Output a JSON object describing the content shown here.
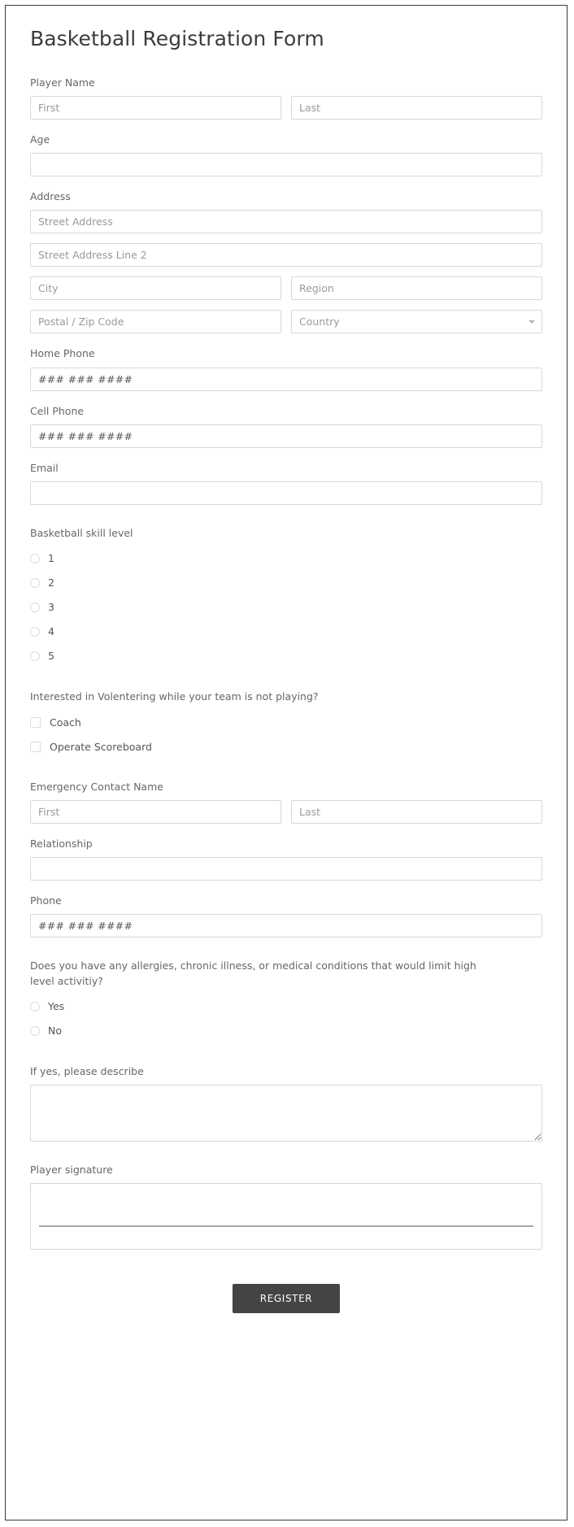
{
  "form": {
    "title": "Basketball Registration Form",
    "submit_label": "REGISTER"
  },
  "colors": {
    "button_background": "#444444",
    "button_text": "#ffffff",
    "label_text": "#666666",
    "input_border": "#d8d8d8",
    "page_border": "#3a3a3a",
    "placeholder": "#9a9a9a"
  },
  "player_name": {
    "label": "Player Name",
    "first_placeholder": "First",
    "first_value": "",
    "last_placeholder": "Last",
    "last_value": ""
  },
  "age": {
    "label": "Age",
    "placeholder": "",
    "value": ""
  },
  "address": {
    "label": "Address",
    "street_placeholder": "Street Address",
    "street_value": "",
    "street2_placeholder": "Street Address Line 2",
    "street2_value": "",
    "city_placeholder": "City",
    "city_value": "",
    "region_placeholder": "Region",
    "region_value": "",
    "postal_placeholder": "Postal / Zip Code",
    "postal_value": "",
    "country_placeholder": "Country",
    "country_value": "",
    "country_chevron": "chevron-down-icon"
  },
  "home_phone": {
    "label": "Home Phone",
    "placeholder": "### ### ####",
    "value": ""
  },
  "cell_phone": {
    "label": "Cell Phone",
    "placeholder": "### ### ####",
    "value": ""
  },
  "email": {
    "label": "Email",
    "placeholder": "",
    "value": ""
  },
  "skill_level": {
    "label": "Basketball skill level",
    "options": [
      {
        "label": "1",
        "selected": false
      },
      {
        "label": "2",
        "selected": false
      },
      {
        "label": "3",
        "selected": false
      },
      {
        "label": "4",
        "selected": false
      },
      {
        "label": "5",
        "selected": false
      }
    ]
  },
  "volunteering": {
    "label": "Interested in Volentering while your team is not playing?",
    "options": [
      {
        "label": "Coach",
        "checked": false
      },
      {
        "label": "Operate Scoreboard",
        "checked": false
      }
    ]
  },
  "emergency_contact": {
    "label": "Emergency Contact Name",
    "first_placeholder": "First",
    "first_value": "",
    "last_placeholder": "Last",
    "last_value": ""
  },
  "relationship": {
    "label": "Relationship",
    "placeholder": "",
    "value": ""
  },
  "emergency_phone": {
    "label": "Phone",
    "placeholder": "### ### ####",
    "value": ""
  },
  "medical": {
    "label": "Does you have any allergies, chronic illness, or medical conditions that would limit high level activitiy?",
    "options": [
      {
        "label": "Yes",
        "selected": false
      },
      {
        "label": "No",
        "selected": false
      }
    ]
  },
  "describe": {
    "label": "If yes, please describe",
    "placeholder": "",
    "value": ""
  },
  "signature": {
    "label": "Player signature",
    "value": ""
  }
}
